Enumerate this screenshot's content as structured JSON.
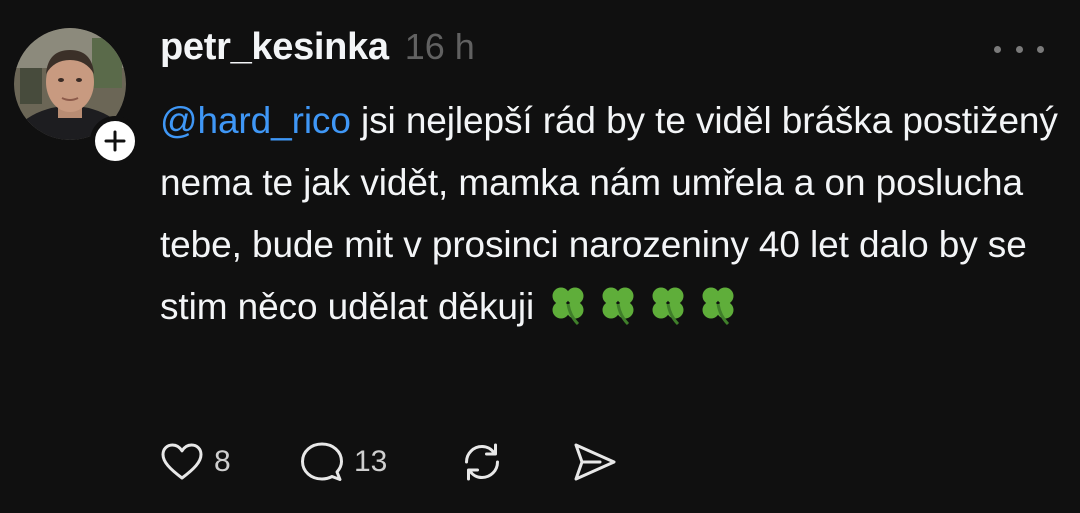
{
  "post": {
    "username": "petr_kesinka",
    "time": "16 h",
    "mention": "@hard_rico",
    "text": " jsi nejlepší rád by te viděl bráška postižený nema te jak vidět, mamka nám umřela a on poslucha tebe, bude mit v prosinci narozeniny 40 let dalo by se stim něco udělat  děkuji",
    "emoji_count": 4,
    "emoji": "four-leaf-clover"
  },
  "actions": {
    "likes": "8",
    "replies": "13"
  },
  "icons": {
    "like": "heart-icon",
    "reply": "comment-icon",
    "repost": "repost-icon",
    "share": "send-icon",
    "more": "more-icon",
    "follow": "plus-icon"
  },
  "colors": {
    "background": "#101010",
    "text": "#f3f5f7",
    "secondary": "#616161",
    "mention": "#3f97f6",
    "clover": "#5fae3a"
  }
}
